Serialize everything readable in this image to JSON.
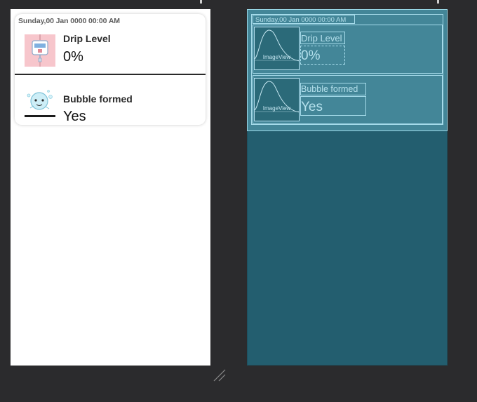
{
  "design": {
    "date": "Sunday,00 Jan 0000 00:00 AM",
    "rows": [
      {
        "title": "Drip Level",
        "value": "0%",
        "icon": "iv-drip-bag-icon"
      },
      {
        "title": "Bubble formed",
        "value": "Yes",
        "icon": "bubble-character-icon"
      }
    ]
  },
  "blueprint": {
    "date": "Sunday,00 Jan 0000 00:00 AM",
    "imageview_label": "ImageView",
    "rows": [
      {
        "title": "Drip Level",
        "value": "0%"
      },
      {
        "title": "Bubble formed",
        "value": "Yes"
      }
    ]
  },
  "colors": {
    "canvas_bg": "#2b2b2d",
    "blueprint_bg": "#235e6f",
    "drip_icon_bg": "#f7c6cc"
  }
}
